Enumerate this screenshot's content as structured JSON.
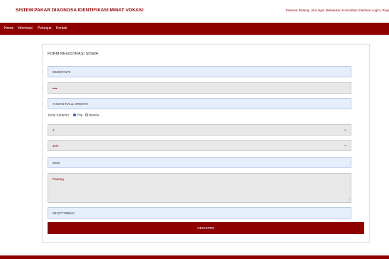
{
  "header": {
    "site_title": "SISTEM PAKAR DIAGNOSA IDENTIFIKASI MINAT VOKASI",
    "welcome_text": "Selamat Datang, Jika Ingin Melakukan Konsultasi Silahkan Login | Regi"
  },
  "nav": {
    "items": [
      {
        "label": "Home"
      },
      {
        "label": "Informasi"
      },
      {
        "label": "Petunjuk"
      },
      {
        "label": "Kontak"
      }
    ]
  },
  "form": {
    "title": "FORM REGISTRASI SISWA",
    "nis": "0020070172",
    "password": "••••",
    "name": "AHMAD RAUL GREGTA",
    "gender_label": "Jenis Kelamin :",
    "gender_options": [
      "Pria",
      "Wanita"
    ],
    "gender_selected": "Pria",
    "day": "2",
    "month": "Juni",
    "year": "2002",
    "address_placeholder": "Padang",
    "phone": "081277798542",
    "register_label": "REGISTER"
  },
  "colors": {
    "brand": "#8f0000",
    "field_blue": "#e6eefb",
    "field_grey": "#e8e8e8"
  }
}
